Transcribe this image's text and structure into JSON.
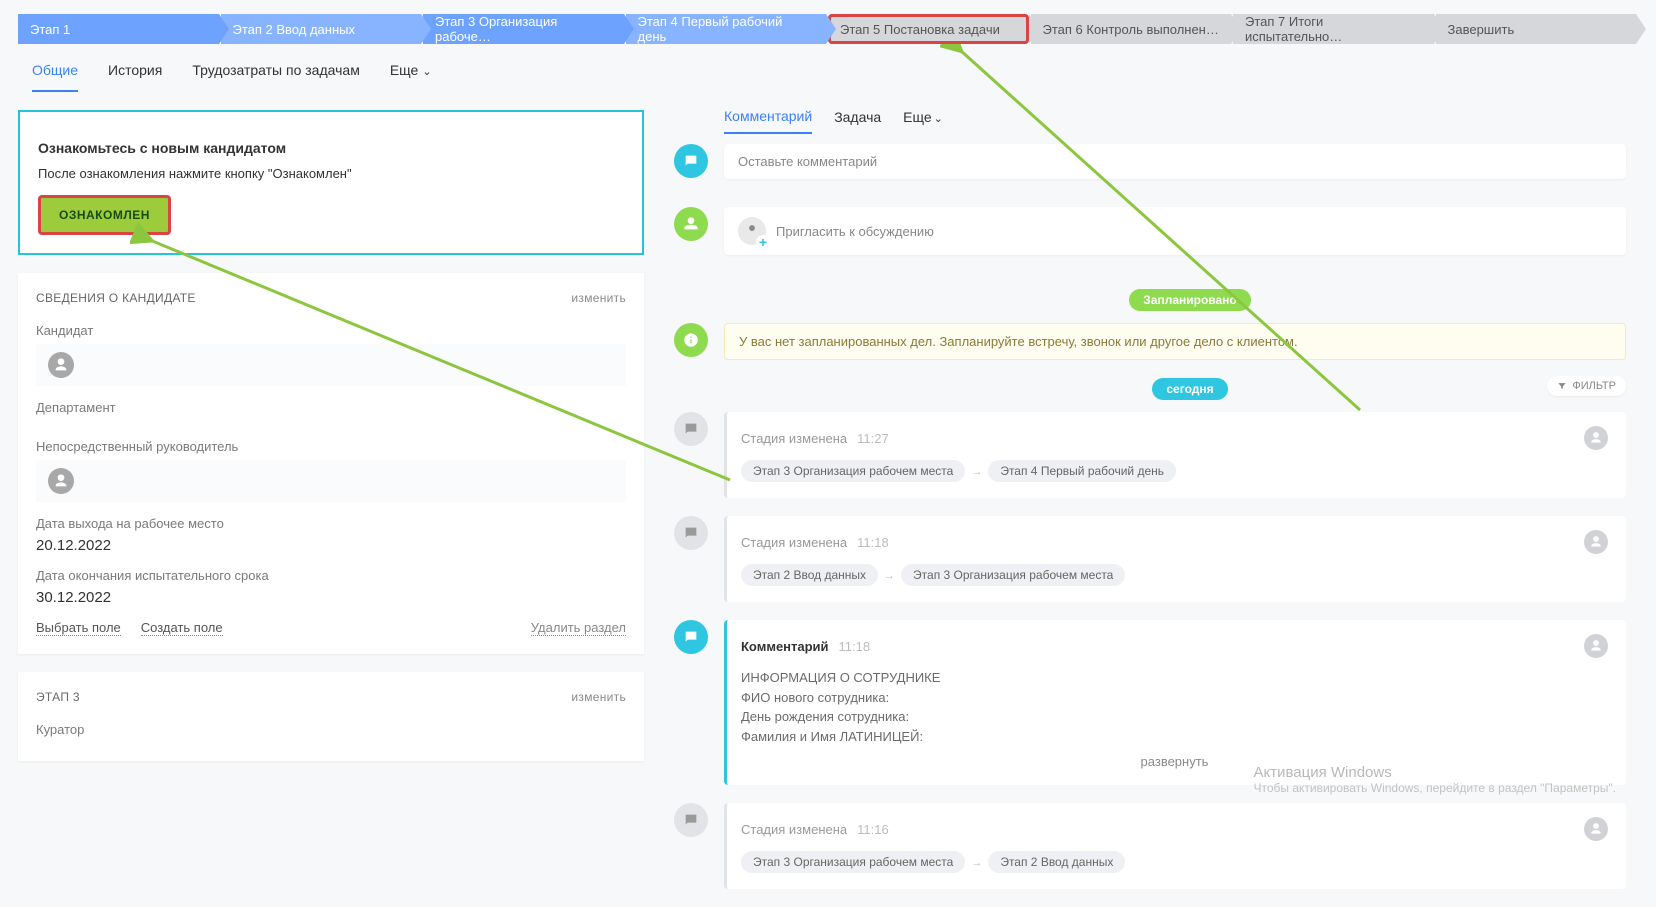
{
  "stages": [
    {
      "label": "Этап 1",
      "style": "blue-solid"
    },
    {
      "label": "Этап 2 Ввод данных",
      "style": "blue-light"
    },
    {
      "label": "Этап 3 Организация рабоче…",
      "style": "blue-solid"
    },
    {
      "label": "Этап 4 Первый рабочий день",
      "style": "blue-light"
    },
    {
      "label": "Этап 5 Постановка задачи",
      "style": "grey",
      "highlight": true
    },
    {
      "label": "Этап 6 Контроль выполнен…",
      "style": "grey"
    },
    {
      "label": "Этап 7 Итоги испытательно…",
      "style": "grey"
    },
    {
      "label": "Завершить",
      "style": "grey"
    }
  ],
  "left_tabs": [
    {
      "label": "Общие",
      "active": true
    },
    {
      "label": "История"
    },
    {
      "label": "Трудозатраты по задачам"
    },
    {
      "label": "Еще",
      "sub": true
    }
  ],
  "infobox": {
    "title": "Ознакомьтесь с новым кандидатом",
    "text": "После ознакомления нажмите кнопку \"Ознакомлен\"",
    "button": "ОЗНАКОМЛЕН"
  },
  "candidate_panel": {
    "head": "СВЕДЕНИЯ О КАНДИДАТЕ",
    "edit": "изменить",
    "fields": {
      "candidate_label": "Кандидат",
      "department_label": "Департамент",
      "supervisor_label": "Непосредственный руководитель",
      "date_out_label": "Дата выхода на рабочее место",
      "date_out_value": "20.12.2022",
      "date_end_label": "Дата окончания испытательного срока",
      "date_end_value": "30.12.2022"
    },
    "actions": {
      "select": "Выбрать поле",
      "create": "Создать поле",
      "delete": "Удалить раздел"
    }
  },
  "stage3_panel": {
    "head": "ЭТАП 3",
    "edit": "изменить",
    "curator_label": "Куратор"
  },
  "right_tabs": [
    {
      "label": "Комментарий",
      "active": true
    },
    {
      "label": "Задача"
    },
    {
      "label": "Еще",
      "sub": true
    }
  ],
  "comment_placeholder": "Оставьте комментарий",
  "invite_label": "Пригласить к обсуждению",
  "chip_planned": "Запланировано",
  "warn_text": "У вас нет запланированных дел. Запланируйте встречу, звонок или другое дело с клиентом.",
  "chip_today": "сегодня",
  "filter_label": "ФИЛЬТР",
  "log": [
    {
      "kind": "neutral",
      "title": "Стадия изменена",
      "time": "11:27",
      "chips": [
        "Этап 3 Организация рабочем места",
        "Этап 4 Первый рабочий день"
      ]
    },
    {
      "kind": "neutral",
      "title": "Стадия изменена",
      "time": "11:18",
      "chips": [
        "Этап 2 Ввод данных",
        "Этап 3 Организация рабочем места"
      ]
    },
    {
      "kind": "comment",
      "title": "Комментарий",
      "time": "11:18",
      "lines": [
        "ИНФОРМАЦИЯ О СОТРУДНИКЕ",
        "ФИО нового сотрудника:",
        "День рождения сотрудника:",
        "Фамилия и Имя ЛАТИНИЦЕЙ:"
      ],
      "expand": "развернуть"
    },
    {
      "kind": "neutral",
      "title": "Стадия изменена",
      "time": "11:16",
      "chips": [
        "Этап 3 Организация рабочем места",
        "Этап 2 Ввод данных"
      ]
    }
  ],
  "watermark": {
    "l1": "Активация Windows",
    "l2": "Чтобы активировать Windows, перейдите в раздел \"Параметры\"."
  }
}
